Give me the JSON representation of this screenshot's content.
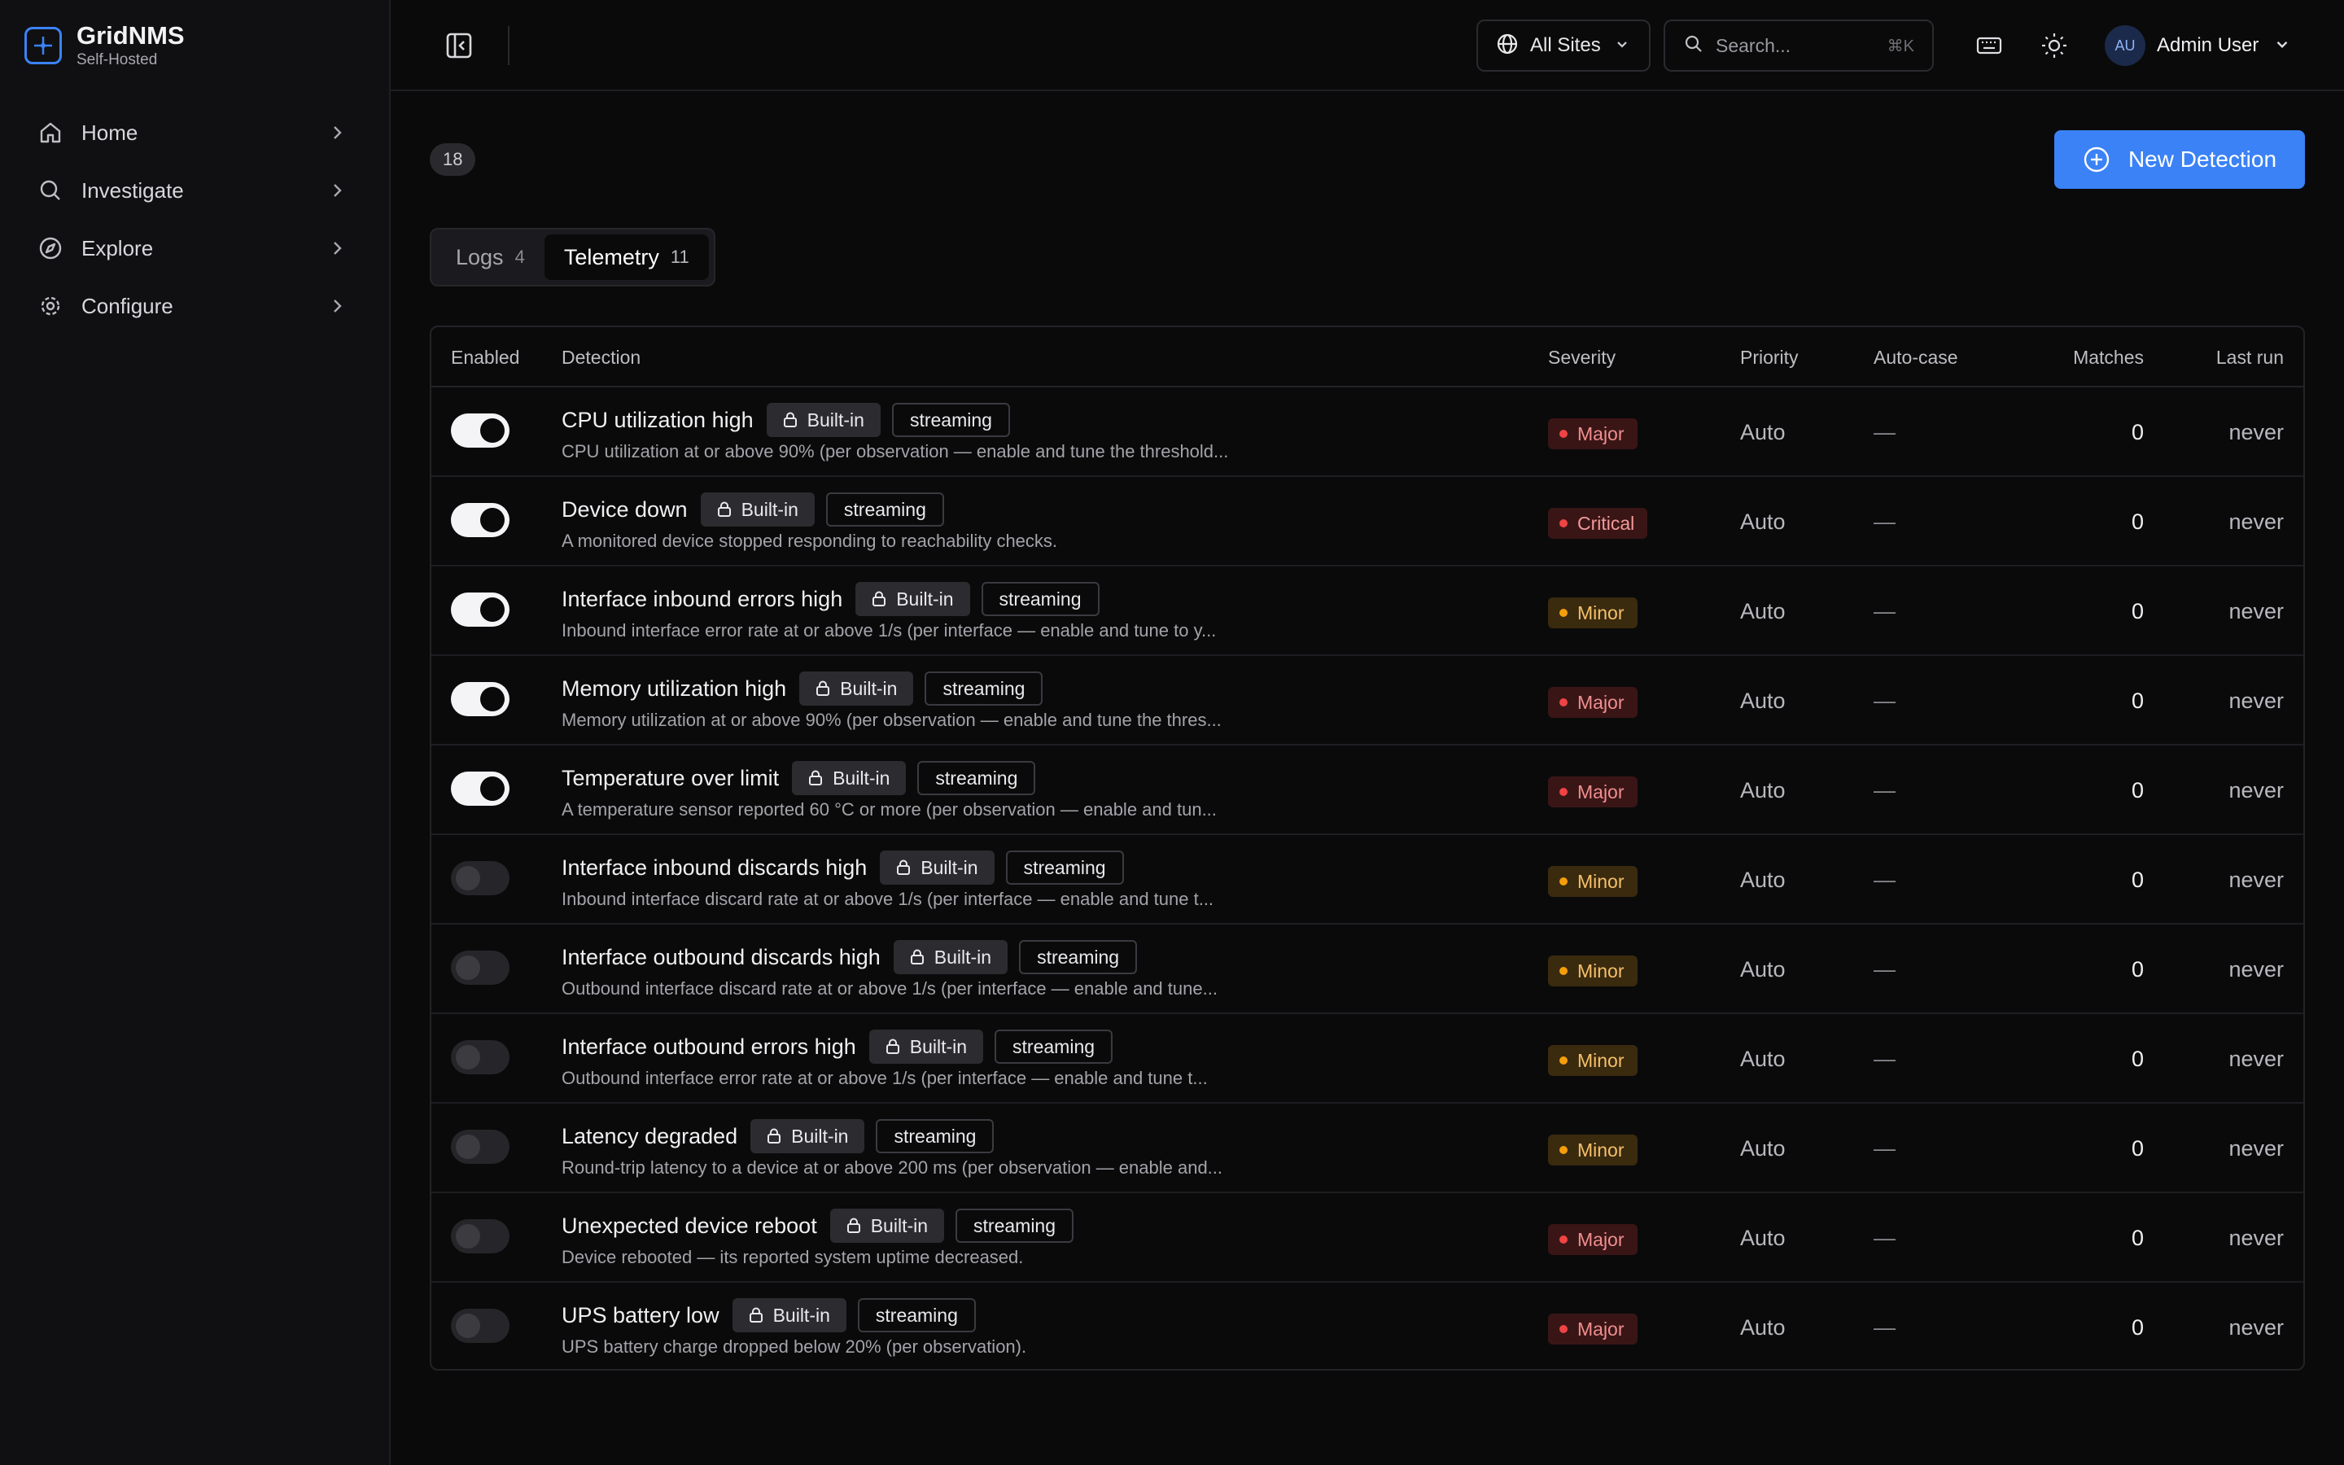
{
  "brand": {
    "title": "GridNMS",
    "subtitle": "Self-Hosted",
    "accent": "#3b82f6"
  },
  "sidebar": {
    "items": [
      {
        "label": "Home",
        "icon": "home-icon"
      },
      {
        "label": "Investigate",
        "icon": "search-icon"
      },
      {
        "label": "Explore",
        "icon": "compass-icon"
      },
      {
        "label": "Configure",
        "icon": "gear-icon"
      }
    ]
  },
  "topbar": {
    "sites_label": "All Sites",
    "search_placeholder": "Search...",
    "search_shortcut": "⌘K",
    "user_initials": "AU",
    "user_name": "Admin User"
  },
  "main": {
    "total_count": "18",
    "new_button_label": "New Detection",
    "tabs": [
      {
        "label": "Logs",
        "count": "4",
        "active": false
      },
      {
        "label": "Telemetry",
        "count": "11",
        "active": true
      }
    ]
  },
  "table": {
    "headers": {
      "enabled": "Enabled",
      "detection": "Detection",
      "severity": "Severity",
      "priority": "Priority",
      "autocase": "Auto-case",
      "matches": "Matches",
      "lastrun": "Last run"
    },
    "builtin_label": "Built-in",
    "stream_label": "streaming",
    "rows": [
      {
        "enabled": true,
        "name": "CPU utilization high",
        "desc": "CPU utilization at or above 90% (per observation — enable and tune the threshold...",
        "severity": "Major",
        "priority": "Auto",
        "autocase": "—",
        "matches": "0",
        "lastrun": "never"
      },
      {
        "enabled": true,
        "name": "Device down",
        "desc": "A monitored device stopped responding to reachability checks.",
        "severity": "Critical",
        "priority": "Auto",
        "autocase": "—",
        "matches": "0",
        "lastrun": "never"
      },
      {
        "enabled": true,
        "name": "Interface inbound errors high",
        "desc": "Inbound interface error rate at or above 1/s (per interface — enable and tune to y...",
        "severity": "Minor",
        "priority": "Auto",
        "autocase": "—",
        "matches": "0",
        "lastrun": "never"
      },
      {
        "enabled": true,
        "name": "Memory utilization high",
        "desc": "Memory utilization at or above 90% (per observation — enable and tune the thres...",
        "severity": "Major",
        "priority": "Auto",
        "autocase": "—",
        "matches": "0",
        "lastrun": "never"
      },
      {
        "enabled": true,
        "name": "Temperature over limit",
        "desc": "A temperature sensor reported 60 °C or more (per observation — enable and tun...",
        "severity": "Major",
        "priority": "Auto",
        "autocase": "—",
        "matches": "0",
        "lastrun": "never"
      },
      {
        "enabled": false,
        "name": "Interface inbound discards high",
        "desc": "Inbound interface discard rate at or above 1/s (per interface — enable and tune t...",
        "severity": "Minor",
        "priority": "Auto",
        "autocase": "—",
        "matches": "0",
        "lastrun": "never"
      },
      {
        "enabled": false,
        "name": "Interface outbound discards high",
        "desc": "Outbound interface discard rate at or above 1/s (per interface — enable and tune...",
        "severity": "Minor",
        "priority": "Auto",
        "autocase": "—",
        "matches": "0",
        "lastrun": "never"
      },
      {
        "enabled": false,
        "name": "Interface outbound errors high",
        "desc": "Outbound interface error rate at or above 1/s (per interface — enable and tune t...",
        "severity": "Minor",
        "priority": "Auto",
        "autocase": "—",
        "matches": "0",
        "lastrun": "never"
      },
      {
        "enabled": false,
        "name": "Latency degraded",
        "desc": "Round-trip latency to a device at or above 200 ms (per observation — enable and...",
        "severity": "Minor",
        "priority": "Auto",
        "autocase": "—",
        "matches": "0",
        "lastrun": "never"
      },
      {
        "enabled": false,
        "name": "Unexpected device reboot",
        "desc": "Device rebooted — its reported system uptime decreased.",
        "severity": "Major",
        "priority": "Auto",
        "autocase": "—",
        "matches": "0",
        "lastrun": "never"
      },
      {
        "enabled": false,
        "name": "UPS battery low",
        "desc": "UPS battery charge dropped below 20% (per observation).",
        "severity": "Major",
        "priority": "Auto",
        "autocase": "—",
        "matches": "0",
        "lastrun": "never"
      }
    ]
  }
}
